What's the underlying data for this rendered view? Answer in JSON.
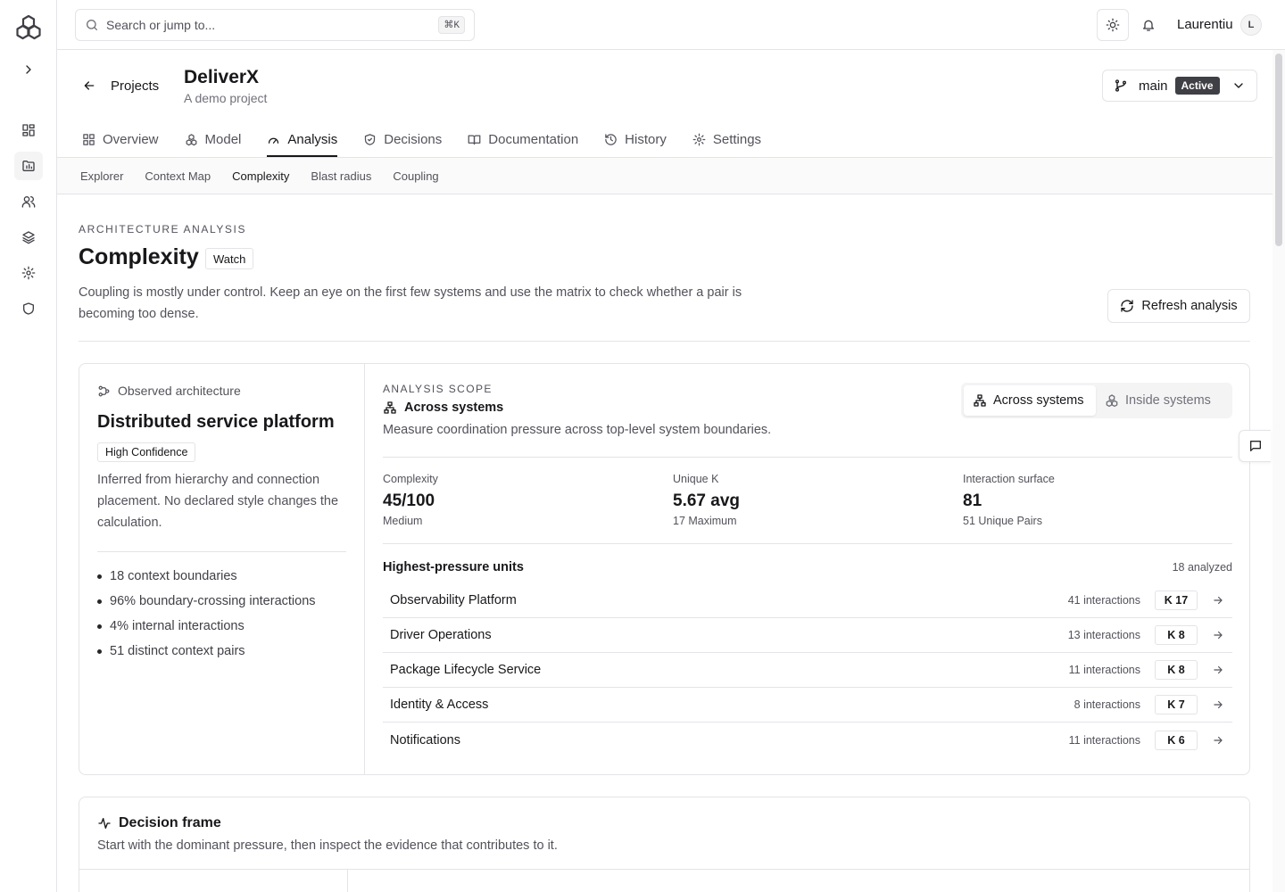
{
  "topbar": {
    "search_placeholder": "Search or jump to...",
    "search_shortcut": "⌘K",
    "user_name": "Laurentiu",
    "user_initial": "L"
  },
  "header": {
    "back_label": "Projects",
    "project_title": "DeliverX",
    "project_subtitle": "A demo project",
    "branch_name": "main",
    "branch_status": "Active"
  },
  "tabs": [
    {
      "label": "Overview",
      "icon": "grid-icon"
    },
    {
      "label": "Model",
      "icon": "cubes-icon"
    },
    {
      "label": "Analysis",
      "icon": "gauge-icon",
      "active": true
    },
    {
      "label": "Decisions",
      "icon": "shield-check-icon"
    },
    {
      "label": "Documentation",
      "icon": "book-icon"
    },
    {
      "label": "History",
      "icon": "history-icon"
    },
    {
      "label": "Settings",
      "icon": "gear-icon"
    }
  ],
  "subtabs": [
    {
      "label": "Explorer"
    },
    {
      "label": "Context Map"
    },
    {
      "label": "Complexity",
      "active": true
    },
    {
      "label": "Blast radius"
    },
    {
      "label": "Coupling"
    }
  ],
  "page": {
    "eyebrow": "ARCHITECTURE ANALYSIS",
    "title": "Complexity",
    "status_badge": "Watch",
    "description": "Coupling is mostly under control. Keep an eye on the first few systems and use the matrix to check whether a pair is becoming too dense.",
    "refresh_label": "Refresh analysis"
  },
  "architecture": {
    "label": "Observed architecture",
    "title": "Distributed service platform",
    "confidence": "High Confidence",
    "description": "Inferred from hierarchy and connection placement. No declared style changes the calculation.",
    "bullets": [
      "18 context boundaries",
      "96% boundary-crossing interactions",
      "4% internal interactions",
      "51 distinct context pairs"
    ]
  },
  "scope": {
    "eyebrow": "ANALYSIS SCOPE",
    "title": "Across systems",
    "description": "Measure coordination pressure across top-level system boundaries.",
    "options": [
      {
        "label": "Across systems",
        "active": true
      },
      {
        "label": "Inside systems"
      }
    ]
  },
  "metrics": [
    {
      "label": "Complexity",
      "value": "45/100",
      "sub": "Medium"
    },
    {
      "label": "Unique K",
      "value": "5.67 avg",
      "sub": "17 Maximum"
    },
    {
      "label": "Interaction surface",
      "value": "81",
      "sub": "51 Unique Pairs"
    }
  ],
  "units": {
    "heading": "Highest-pressure units",
    "count": "18 analyzed",
    "rows": [
      {
        "name": "Observability Platform",
        "interactions": "41 interactions",
        "k": "K 17"
      },
      {
        "name": "Driver Operations",
        "interactions": "13 interactions",
        "k": "K 8"
      },
      {
        "name": "Package Lifecycle Service",
        "interactions": "11 interactions",
        "k": "K 8"
      },
      {
        "name": "Identity & Access",
        "interactions": "8 interactions",
        "k": "K 7"
      },
      {
        "name": "Notifications",
        "interactions": "11 interactions",
        "k": "K 6"
      }
    ]
  },
  "decision": {
    "title": "Decision frame",
    "description": "Start with the dominant pressure, then inspect the evidence that contributes to it."
  }
}
